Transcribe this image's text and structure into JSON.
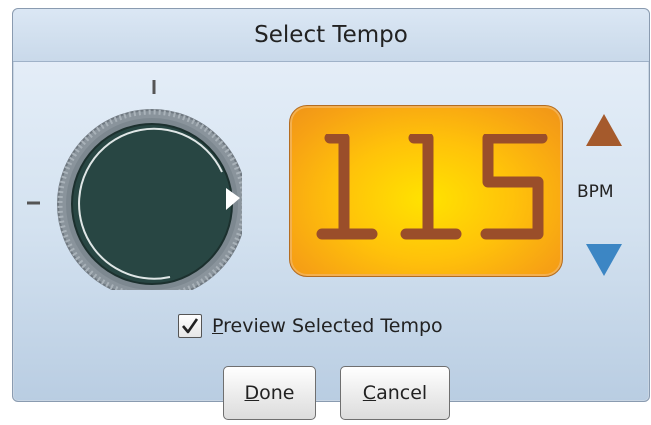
{
  "dialog": {
    "title": "Select Tempo"
  },
  "tempo": {
    "value": "115",
    "unit": "BPM"
  },
  "colors": {
    "dial_body": "#284643",
    "dial_ring": "#7f8a93",
    "lcd_digits": "#9a4e2a",
    "arrow_up": "#a55a2c",
    "arrow_down": "#3c86c4"
  },
  "icons": {
    "increase": "triangle-up-icon",
    "decrease": "triangle-down-icon",
    "check": "checkmark-icon"
  },
  "preview": {
    "checked": true,
    "mnemonic": "P",
    "label_rest": "review Selected Tempo"
  },
  "buttons": {
    "done_mnemonic": "D",
    "done_rest": "one",
    "cancel_mnemonic": "C",
    "cancel_rest": "ancel"
  }
}
